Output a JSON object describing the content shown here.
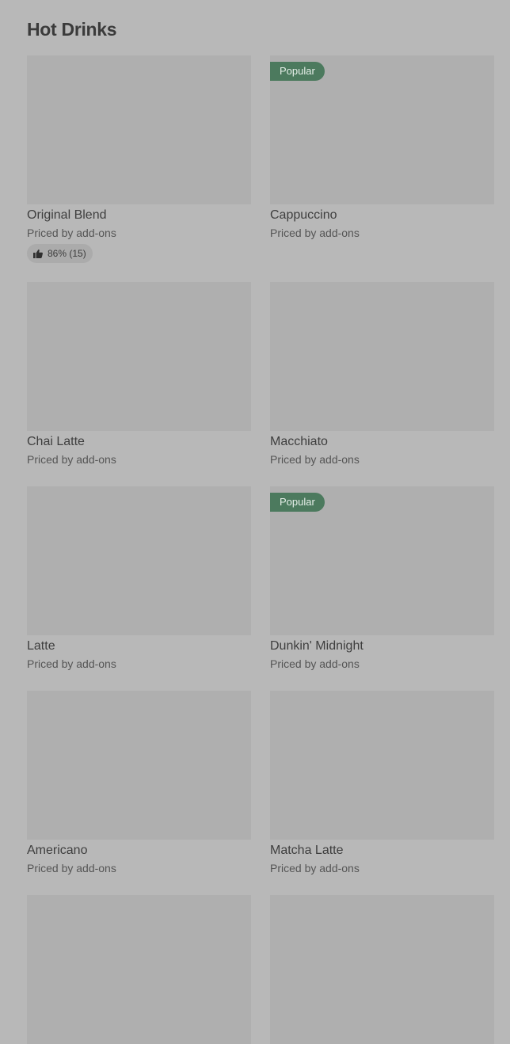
{
  "section": {
    "title": "Hot Drinks"
  },
  "items": [
    {
      "name": "Original Blend",
      "price": "Priced by add-ons",
      "badge": "",
      "rating": "86% (15)"
    },
    {
      "name": "Cappuccino",
      "price": "Priced by add-ons",
      "badge": "Popular",
      "rating": ""
    },
    {
      "name": "Chai Latte",
      "price": "Priced by add-ons",
      "badge": "",
      "rating": ""
    },
    {
      "name": "Macchiato",
      "price": "Priced by add-ons",
      "badge": "",
      "rating": ""
    },
    {
      "name": "Latte",
      "price": "Priced by add-ons",
      "badge": "",
      "rating": ""
    },
    {
      "name": "Dunkin' Midnight",
      "price": "Priced by add-ons",
      "badge": "Popular",
      "rating": ""
    },
    {
      "name": "Americano",
      "price": "Priced by add-ons",
      "badge": "",
      "rating": ""
    },
    {
      "name": "Matcha Latte",
      "price": "Priced by add-ons",
      "badge": "",
      "rating": ""
    }
  ],
  "icons": {
    "rating": "thumbs-up-icon"
  },
  "colors": {
    "background": "#b8b8b8",
    "thumbnail": "#afafaf",
    "badge": "#4c7a5e"
  }
}
